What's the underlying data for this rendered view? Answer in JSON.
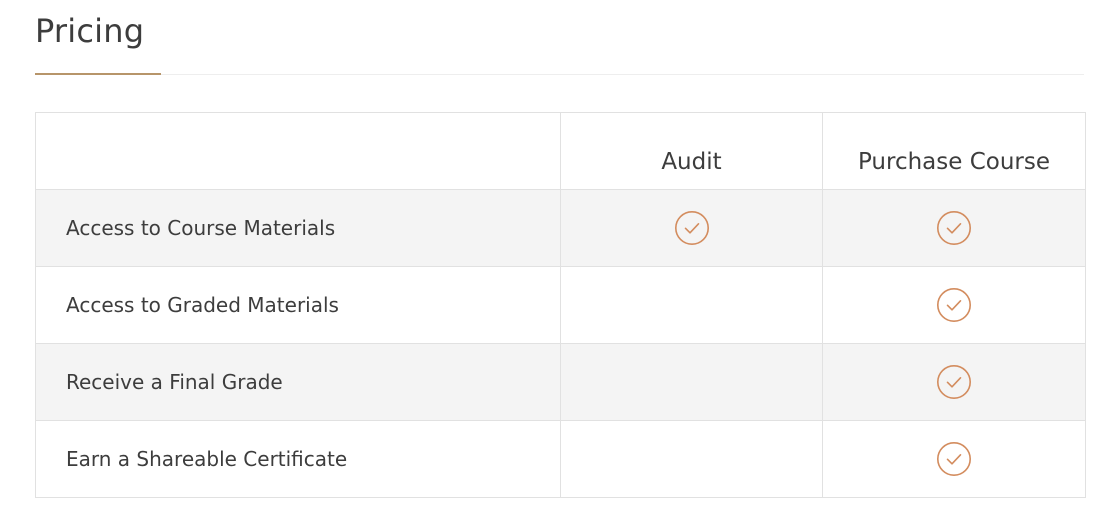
{
  "section": {
    "title": "Pricing"
  },
  "colors": {
    "accent": "#b7956a",
    "check": "#d38c5e",
    "row_alt": "#f4f4f4",
    "border": "#e1e1e1"
  },
  "table": {
    "headers": [
      "",
      "Audit",
      "Purchase Course"
    ],
    "rows": [
      {
        "feature": "Access to Course Materials",
        "audit": true,
        "purchase": true
      },
      {
        "feature": "Access to Graded Materials",
        "audit": false,
        "purchase": true
      },
      {
        "feature": "Receive a Final Grade",
        "audit": false,
        "purchase": true
      },
      {
        "feature": "Earn a Shareable Certificate",
        "audit": false,
        "purchase": true
      }
    ],
    "included_icon": "check-circle-icon"
  }
}
